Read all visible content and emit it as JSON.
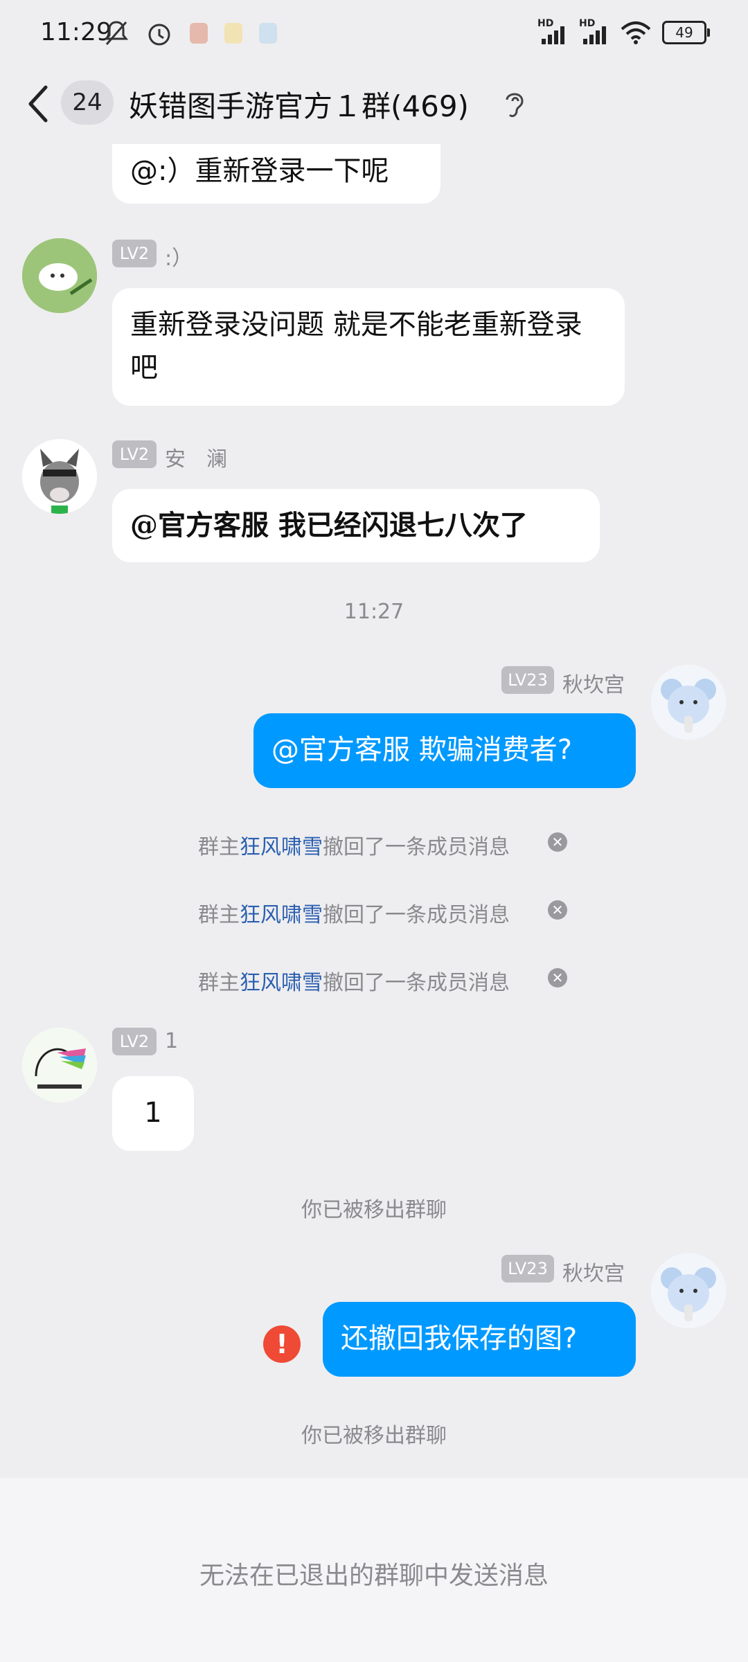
{
  "status_bar": {
    "time": "11:29",
    "battery": "49",
    "net1": "HD",
    "net2": "HD"
  },
  "header": {
    "unread_count": "24",
    "title": "妖错图手游官方１群(469)"
  },
  "messages": {
    "m0": {
      "text": "@:）重新登录一下呢"
    },
    "m1": {
      "level": "LV2",
      "nick": ":）",
      "text": "重新登录没问题 就是不能老重新登录吧"
    },
    "m2": {
      "level": "LV2",
      "nick": "安　澜",
      "text": "@官方客服 我已经闪退七八次了"
    },
    "time_label": "11:27",
    "m3": {
      "level": "LV23",
      "nick": "秋坎宫",
      "text": "@官方客服 欺骗消费者?"
    },
    "recall": {
      "prefix": "群主",
      "name": "狂风啸雪",
      "suffix": "撤回了一条成员消息"
    },
    "m4": {
      "level": "LV2",
      "nick": "1",
      "text": "1"
    },
    "removed_1": "你已被移出群聊",
    "m5": {
      "level": "LV23",
      "nick": "秋坎宫",
      "text": "还撤回我保存的图?"
    },
    "removed_2": "你已被移出群聊"
  },
  "footer": {
    "text": "无法在已退出的群聊中发送消息"
  },
  "icons": {
    "back": "chevron-left-icon",
    "ear": "ear-icon",
    "error": "error-icon",
    "close": "close-icon"
  },
  "colors": {
    "my_bubble": "#0099ff",
    "highlight_name": "#2b5fb0",
    "error": "#ef4a35"
  }
}
